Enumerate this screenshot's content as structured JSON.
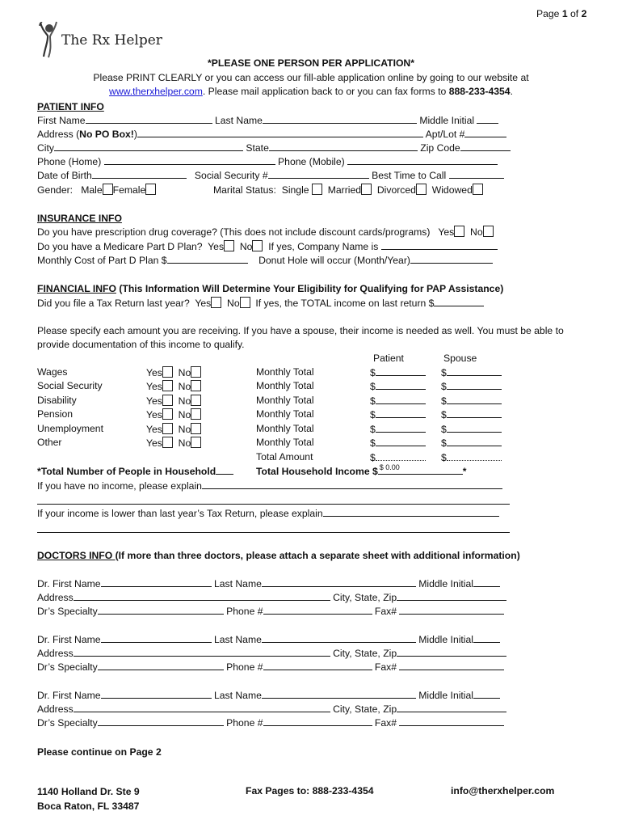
{
  "header": {
    "page_prefix": "Page ",
    "page_current": "1",
    "page_of": " of ",
    "page_total": "2",
    "logo_text": "The Rx Helper",
    "logo_icon": "person-raising-arms-icon"
  },
  "intro": {
    "title": "*PLEASE ONE PERSON PER APPLICATION*",
    "line1": "Please PRINT CLEARLY or you can access our fill-able application online by going to our website at",
    "website": "www.therxhelper.com",
    "line2_mid": ". Please mail application back to or you can fax forms to ",
    "fax": "888-233-4354",
    "line2_end": "."
  },
  "patient": {
    "heading": "PATIENT INFO",
    "first_name": "First Name",
    "last_name": "Last Name",
    "middle_initial": "Middle Initial",
    "address": "Address (",
    "address_bold": "No PO Box!",
    "address_end": ")",
    "apt": "Apt/Lot #",
    "city": "City",
    "state": "State",
    "zip": "Zip Code",
    "phone_home": "Phone (Home)",
    "phone_mobile": "Phone (Mobile)",
    "dob": "Date of Birth",
    "ssn": "Social Security #",
    "best_time": "Best Time to Call",
    "gender": "Gender:",
    "male": "Male",
    "female": "Female",
    "marital": "Marital Status:",
    "single": "Single",
    "married": "Married",
    "divorced": "Divorced",
    "widowed": "Widowed"
  },
  "insurance": {
    "heading": "INSURANCE INFO",
    "q1": "Do you have prescription drug coverage? (This does not include discount cards/programs)",
    "q2": "Do you have a Medicare Part D Plan?",
    "company": "If yes, Company Name is",
    "monthly_cost": "Monthly Cost of Part D Plan $",
    "donut": "Donut Hole will occur (Month/Year)",
    "yes": "Yes",
    "no": "No"
  },
  "financial": {
    "heading": "FINANCIAL INFO",
    "heading_note": " (This Information Will Determine Your Eligibility for Qualifying for PAP Assistance)",
    "tax_q": "Did you file a Tax Return last year?",
    "tax_total": "If yes, the TOTAL income on last return $",
    "yes": "Yes",
    "no": "No",
    "instructions_1": "Please specify each amount you are receiving. If you have a spouse, their income is needed as well. You must be able to",
    "instructions_2": "provide documentation of this income to qualify.",
    "col_patient": "Patient",
    "col_spouse": "Spouse",
    "monthly_total": "Monthly Total",
    "dollar": "$",
    "income_rows": [
      {
        "label": "Wages"
      },
      {
        "label": "Social Security"
      },
      {
        "label": "Disability"
      },
      {
        "label": "Pension"
      },
      {
        "label": "Unemployment"
      },
      {
        "label": "Other"
      }
    ],
    "total_amount": "Total Amount",
    "household_people": "*Total Number of People in Household",
    "household_income": "Total Household Income $",
    "household_income_value": "$ 0.00",
    "asterisk": "*",
    "no_income": "If you have no income, please explain",
    "lower_income": "If your income is lower than last year’s Tax Return, please explain"
  },
  "doctors": {
    "heading": "DOCTORS INFO ",
    "heading_note": "(If more than three doctors, please attach a separate sheet with additional information)",
    "first_name": "Dr. First Name",
    "last_name": "Last Name",
    "middle_initial": "Middle Initial",
    "address": "Address",
    "city_state_zip": "City, State, Zip",
    "specialty": "Dr’s Specialty",
    "phone": "Phone #",
    "fax": "Fax#",
    "count": 3
  },
  "footer": {
    "continue": "Please continue on Page 2",
    "address_1": "1140 Holland Dr. Ste 9",
    "address_2": "Boca Raton, FL 33487",
    "fax": "Fax Pages to: 888-233-4354",
    "email": "info@therxhelper.com"
  }
}
